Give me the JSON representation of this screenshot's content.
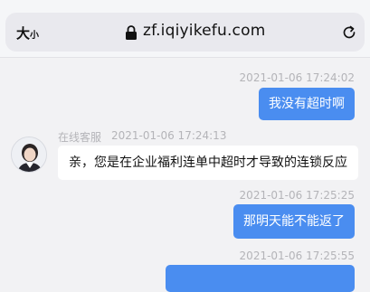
{
  "browser": {
    "text_size_label": "大",
    "text_size_small": "小",
    "url": "zf.iqiyikefu.com"
  },
  "chat": {
    "messages": [
      {
        "timestamp": "2021-01-06 17:24:02",
        "text": "我没有超时啊",
        "from": "user"
      },
      {
        "sender": "在线客服",
        "timestamp": "2021-01-06 17:24:13",
        "text": "亲，您是在企业福利连单中超时才导致的连锁反应",
        "from": "agent"
      },
      {
        "timestamp": "2021-01-06 17:25:25",
        "text": "那明天能不能返了",
        "from": "user"
      },
      {
        "timestamp": "2021-01-06 17:25:55",
        "text": "",
        "from": "user"
      }
    ]
  },
  "colors": {
    "user_bubble": "#4a8df0",
    "agent_bubble": "#ffffff",
    "background": "#f2f2f4"
  },
  "icons": {
    "lock": "lock-icon",
    "reload": "reload-icon",
    "avatar": "agent-avatar"
  }
}
